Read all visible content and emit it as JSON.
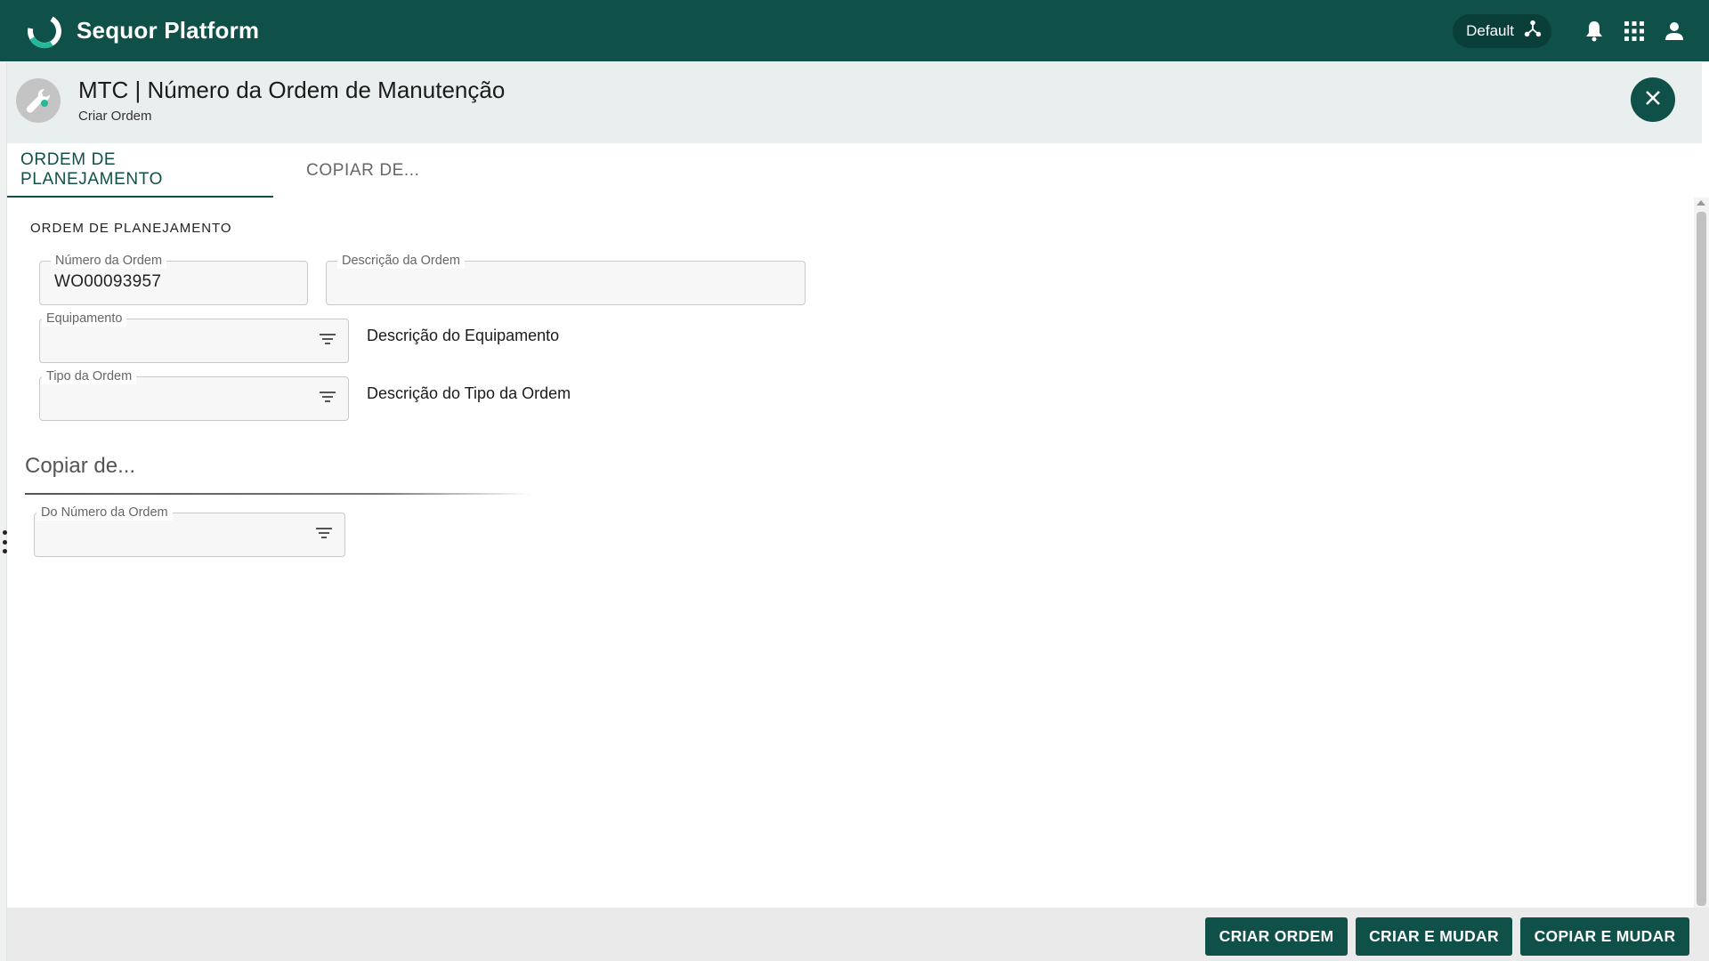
{
  "app": {
    "title": "Sequor Platform"
  },
  "topbar": {
    "environment": "Default"
  },
  "header": {
    "title": "MTC | Número da Ordem de Manutenção",
    "subtitle": "Criar Ordem"
  },
  "tabs": [
    {
      "label": "ORDEM DE PLANEJAMENTO",
      "active": true
    },
    {
      "label": "COPIAR DE...",
      "active": false
    }
  ],
  "form": {
    "section_label": "ORDEM DE PLANEJAMENTO",
    "order_number": {
      "label": "Número da Ordem",
      "value": "WO00093957"
    },
    "order_description": {
      "label": "Descrição da Ordem",
      "value": ""
    },
    "equipment": {
      "label": "Equipamento",
      "value": "",
      "description": "Descrição do Equipamento"
    },
    "order_type": {
      "label": "Tipo da Ordem",
      "value": "",
      "description": "Descrição do Tipo da Ordem"
    }
  },
  "copy_section": {
    "title": "Copiar de...",
    "from_order": {
      "label": "Do Número da Ordem",
      "value": ""
    }
  },
  "footer": {
    "create_order": "CRIAR ORDEM",
    "create_and_change": "CRIAR E MUDAR",
    "copy_and_change": "COPIAR E MUDAR"
  },
  "colors": {
    "primary": "#0f5049",
    "header_bg": "#e9efee",
    "accent": "#24b89a"
  }
}
